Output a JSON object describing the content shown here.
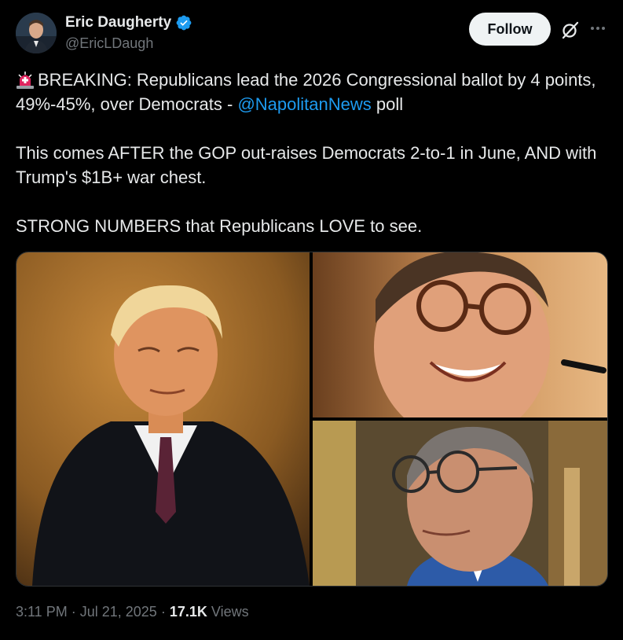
{
  "author": {
    "display_name": "Eric Daugherty",
    "handle": "@EricLDaugh",
    "verified": true,
    "verified_color": "#1d9bf0"
  },
  "header": {
    "follow_label": "Follow",
    "grok_icon": "grok-icon",
    "more_icon": "more-icon"
  },
  "tweet": {
    "emoji": "siren-emoji",
    "line1_prefix": "BREAKING: Republicans lead the 2026 Congressional ballot by 4 points, 49%-45%, over Democrats - ",
    "mention": "@NapolitanNews",
    "line1_suffix": " poll",
    "paragraph2": "This comes AFTER the GOP out-raises Democrats 2-to-1 in June, AND with Trump's $1B+ war chest.",
    "paragraph3": "STRONG NUMBERS that Republicans LOVE to see.",
    "link_color": "#1d9bf0"
  },
  "media": {
    "photos": [
      {
        "alt": "Photo of a man in a dark suit and burgundy tie against a warm amber background"
      },
      {
        "alt": "Photo of a smiling man with glasses at a microphone"
      },
      {
        "alt": "Photo of a man with glasses in a blue suit"
      }
    ]
  },
  "meta": {
    "time": "3:11 PM",
    "separator": "·",
    "date": "Jul 21, 2025",
    "views_count": "17.1K",
    "views_label": "Views"
  }
}
